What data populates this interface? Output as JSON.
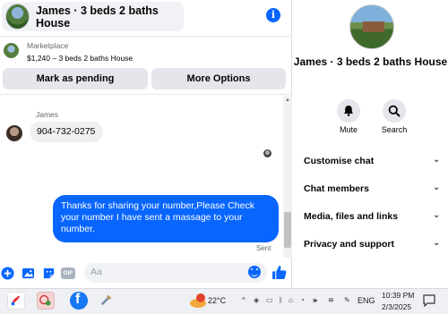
{
  "header": {
    "title": "James · 3 beds 2 baths House",
    "info_icon": "i"
  },
  "marketplace": {
    "label": "Marketplace",
    "listing": "$1,240 – 3 beds 2 baths House"
  },
  "buttons": {
    "mark_pending": "Mark as pending",
    "more_options": "More Options"
  },
  "messages": {
    "sender_name": "James",
    "incoming_text": "904-732-0275",
    "outgoing_text": "Thanks for sharing your number,Please Check your number I have sent a massage to your number.",
    "status": "Sent"
  },
  "composer": {
    "placeholder": "Aa",
    "gif_label": "GIF"
  },
  "side_panel": {
    "title": "James · 3 beds 2 baths House",
    "actions": [
      {
        "label": "Mute",
        "icon": "bell-icon"
      },
      {
        "label": "Search",
        "icon": "search-icon"
      }
    ],
    "menu": [
      {
        "label": "Customise chat"
      },
      {
        "label": "Chat members"
      },
      {
        "label": "Media, files and links"
      },
      {
        "label": "Privacy and support"
      }
    ]
  },
  "taskbar": {
    "weather_badge": "1",
    "temperature": "22°C",
    "language": "ENG",
    "time": "10:39 PM",
    "date": "2/3/2025"
  },
  "colors": {
    "accent": "#0866ff",
    "bubble_in": "#f0f0f0",
    "button_bg": "#e4e6eb"
  }
}
